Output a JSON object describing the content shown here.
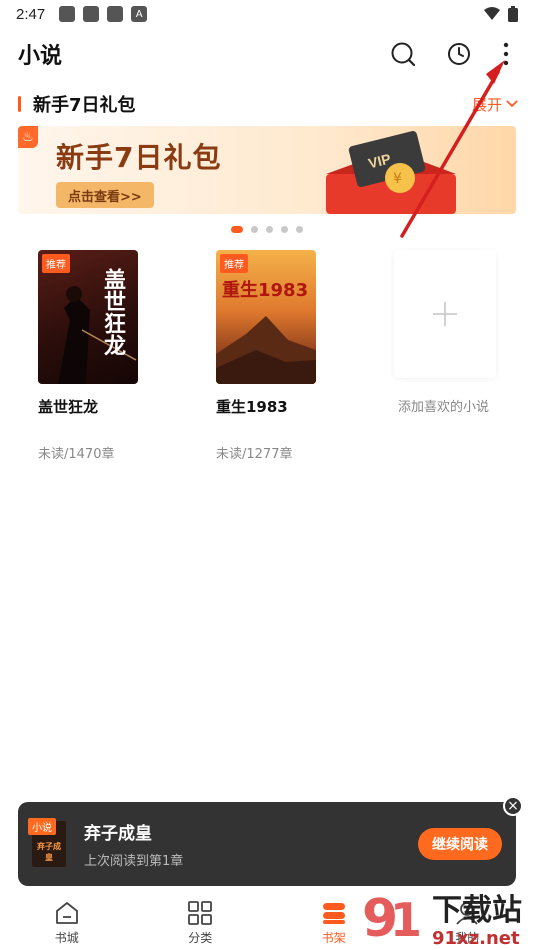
{
  "status_bar": {
    "time": "2:47"
  },
  "app": {
    "title": "小说"
  },
  "gift_section": {
    "title": "新手7日礼包",
    "expand_label": "展开"
  },
  "banner": {
    "title": "新手7日礼包",
    "button_label": "点击查看>>",
    "vip_text": "VIP"
  },
  "carousel": {
    "count": 5,
    "active_index": 0
  },
  "books": [
    {
      "tag": "推荐",
      "cover_title": "盖世狂龙",
      "name": "盖世狂龙",
      "progress": "未读/1470章"
    },
    {
      "tag": "推荐",
      "cover_title": "重生1983",
      "name": "重生1983",
      "progress": "未读/1277章"
    }
  ],
  "add_book": {
    "label": "添加喜欢的小说"
  },
  "continue_reading": {
    "tag": "小说",
    "cover_text": "弃子成皇",
    "title": "弃子成皇",
    "subtitle": "上次阅读到第1章",
    "button_label": "继续阅读"
  },
  "tabs": [
    {
      "label": "书城",
      "icon": "home-icon"
    },
    {
      "label": "分类",
      "icon": "grid-icon"
    },
    {
      "label": "书架",
      "icon": "bookshelf-icon",
      "active": true
    },
    {
      "label": "我的",
      "icon": "user-icon"
    }
  ],
  "watermark": {
    "text": "下载站",
    "url_text": "91xz.net"
  },
  "colors": {
    "accent": "#ff5a1f",
    "dark_panel": "#333333"
  }
}
